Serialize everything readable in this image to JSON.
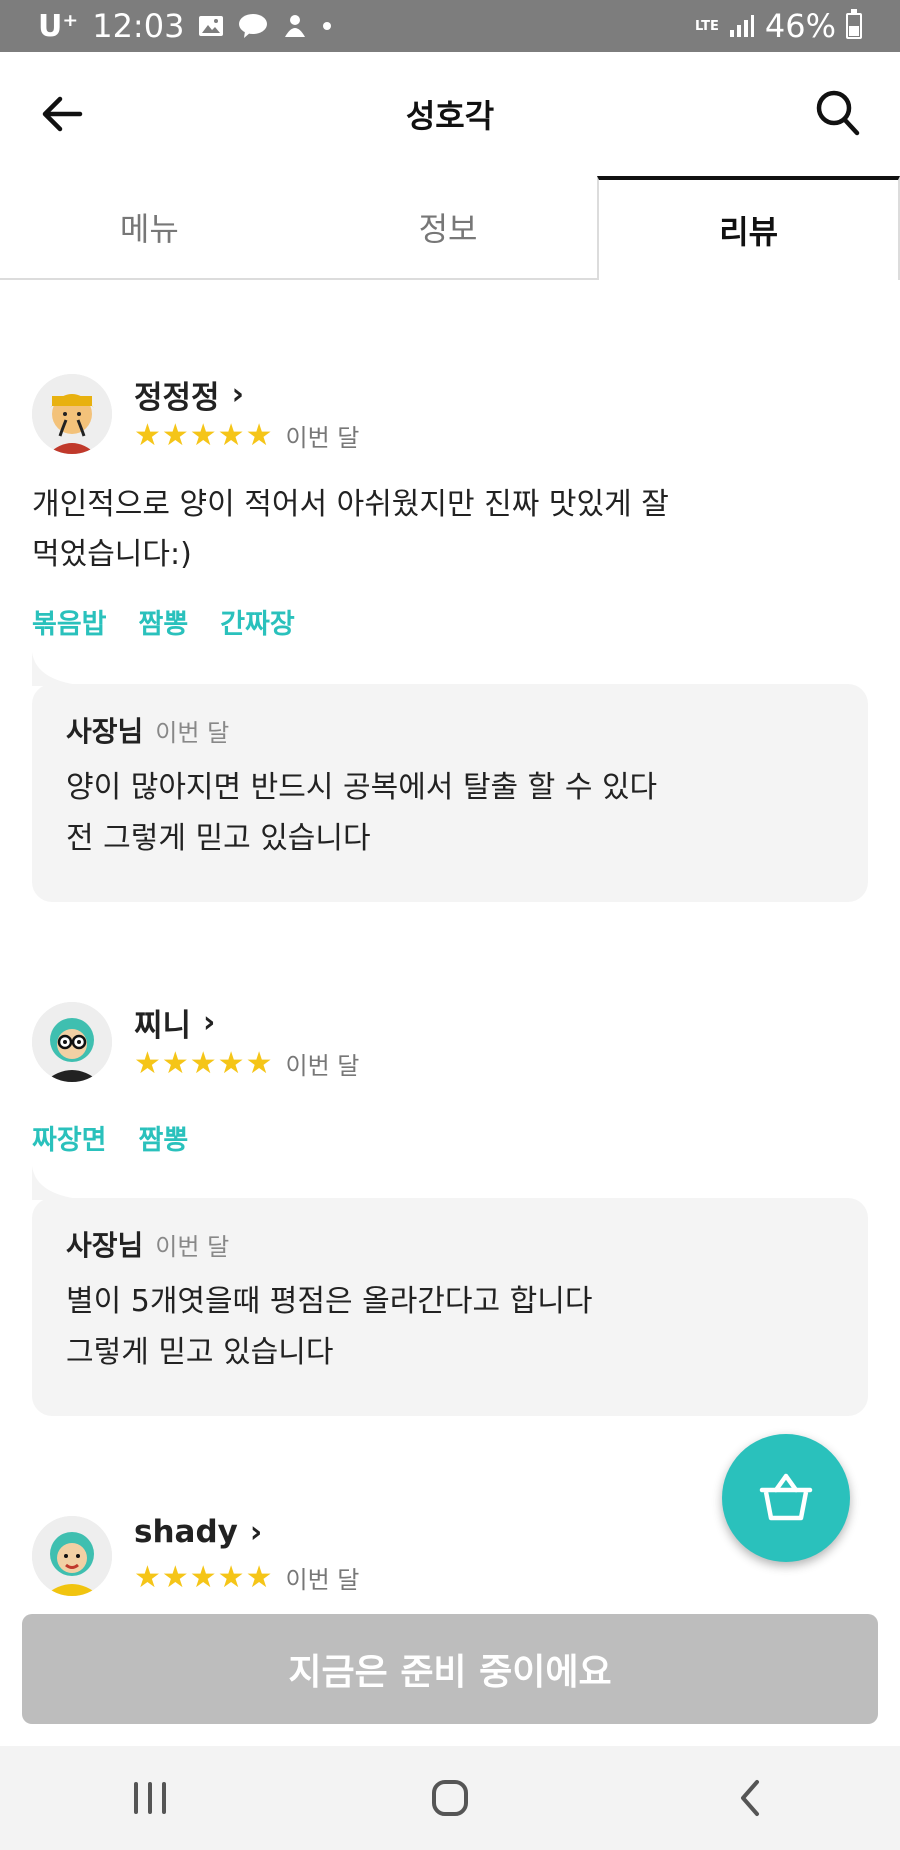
{
  "status_bar": {
    "carrier": "U⁺",
    "time": "12:03",
    "network": "LTE",
    "battery": "46%",
    "battery_level": 0.46
  },
  "header": {
    "title": "성호각"
  },
  "tabs": [
    {
      "label": "메뉴"
    },
    {
      "label": "정보"
    },
    {
      "label": "리뷰"
    }
  ],
  "reviews": [
    {
      "name": "정정정",
      "stars": "★★★★★",
      "rating": 5,
      "date": "이번 달",
      "text": "개인적으로 양이 적어서 아쉬웠지만 진짜 맛있게 잘\n먹었습니다:)",
      "tags": [
        "볶음밥",
        "짬뽕",
        "간짜장"
      ],
      "reply": {
        "owner": "사장님",
        "date": "이번 달",
        "text": "양이 많아지면 반드시 공복에서 탈출 할 수 있다\n전 그렇게 믿고 있습니다"
      }
    },
    {
      "name": "찌니",
      "stars": "★★★★★",
      "rating": 5,
      "date": "이번 달",
      "tags": [
        "짜장면",
        "짬뽕"
      ],
      "reply": {
        "owner": "사장님",
        "date": "이번 달",
        "text": "별이 5개엿을때 평점은 올라간다고 합니다\n그렇게 믿고 있습니다"
      }
    },
    {
      "name": "shady",
      "stars": "★★★★★",
      "rating": 5,
      "date": "이번 달"
    }
  ],
  "bottom_button": {
    "label": "지금은 준비 중이에요"
  },
  "colors": {
    "accent": "#2ac1bc",
    "star": "#f5c518",
    "disabled": "#bdbdbd"
  }
}
